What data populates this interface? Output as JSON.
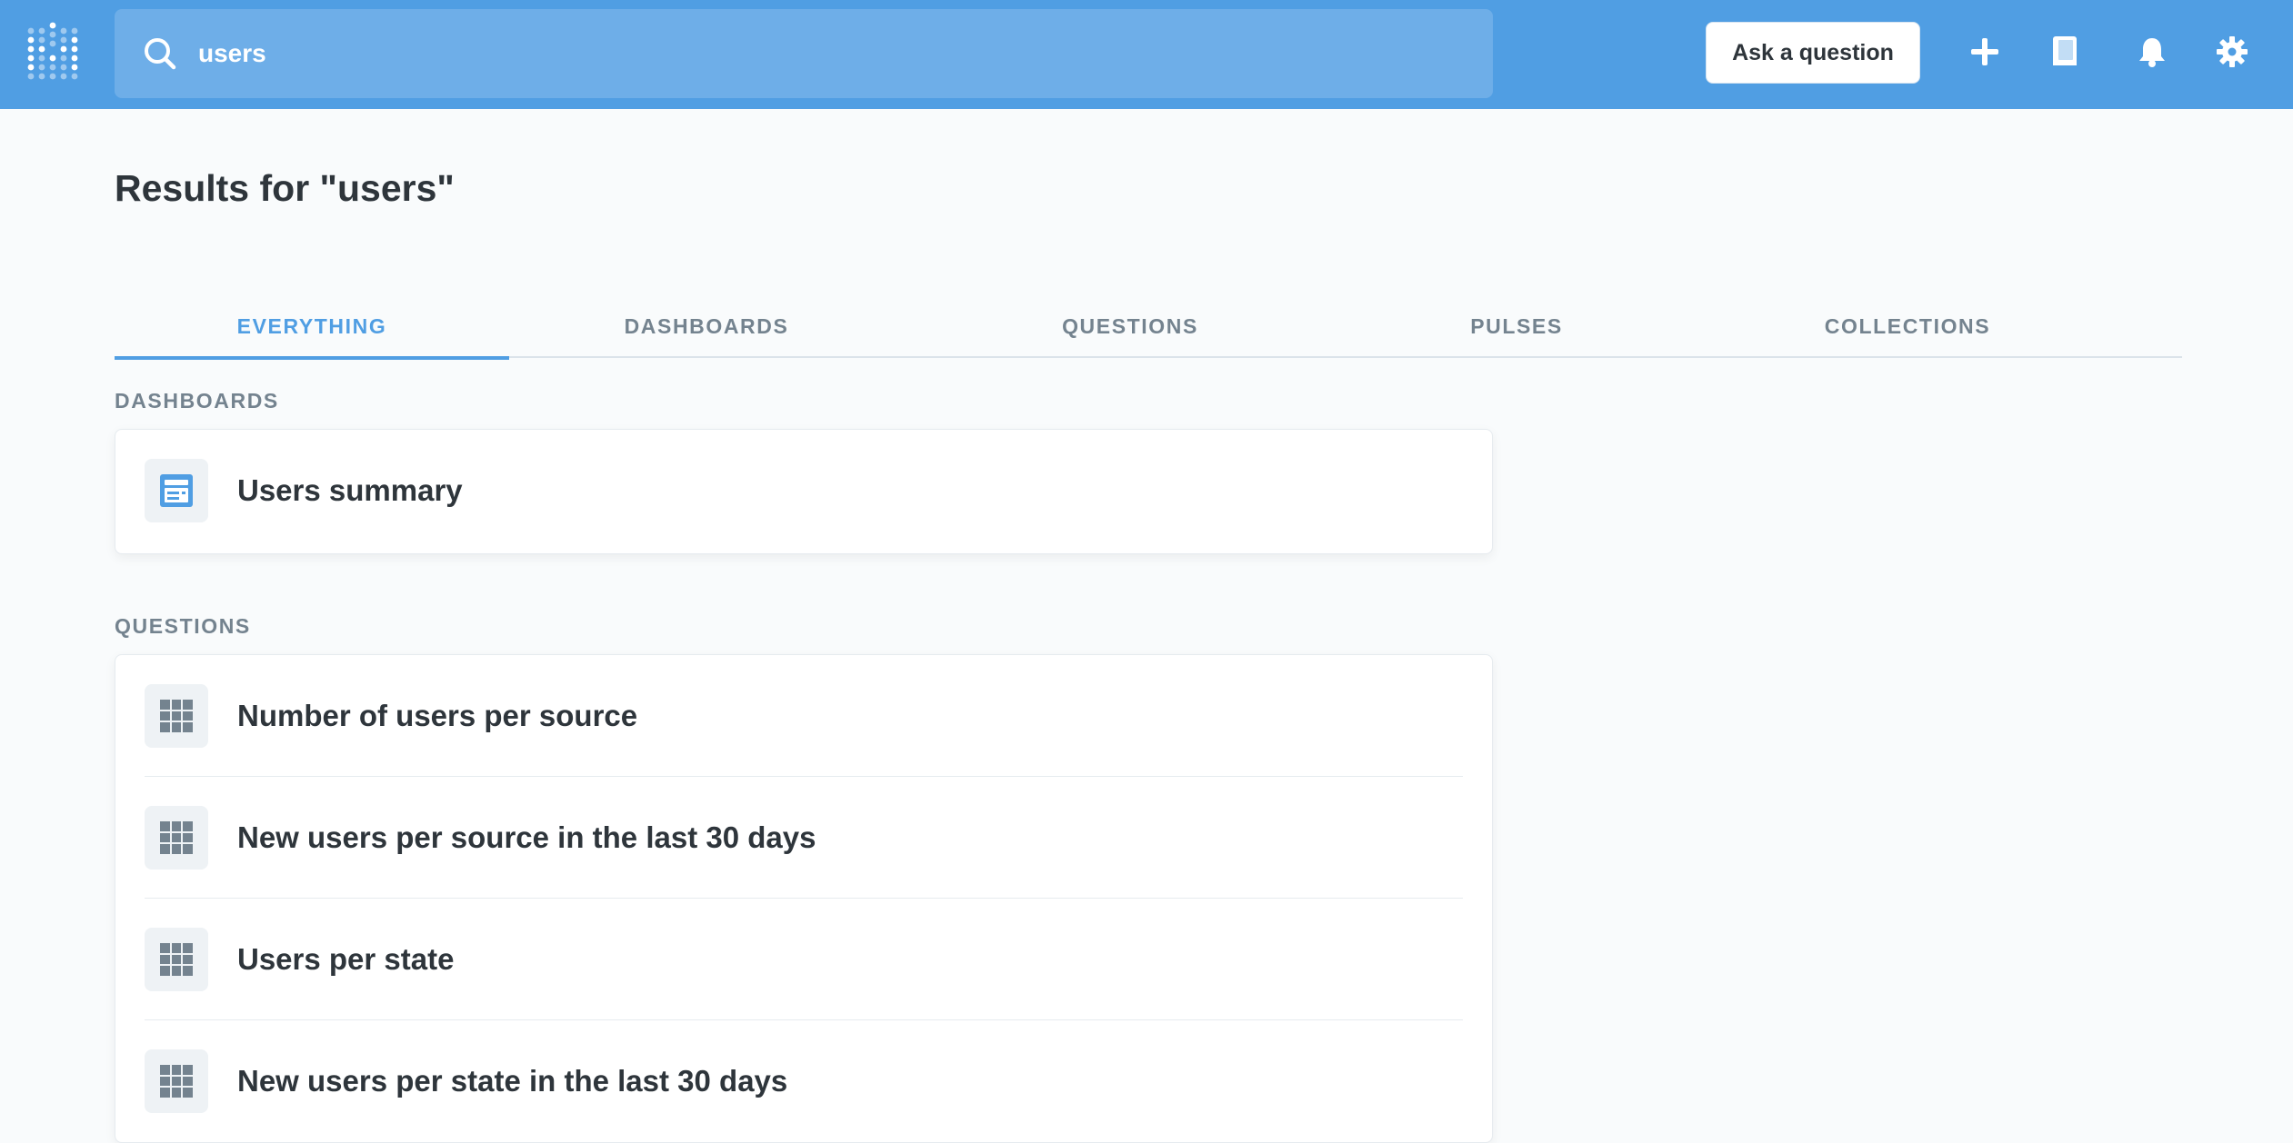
{
  "header": {
    "search": {
      "value": "users",
      "placeholder": "Search…"
    },
    "ask_button_label": "Ask a question",
    "icons": [
      "add-icon",
      "reference-icon",
      "notifications-icon",
      "settings-icon"
    ],
    "brand_color": "#509ee3"
  },
  "page": {
    "title": "Results for \"users\""
  },
  "tabs": [
    {
      "label": "EVERYTHING",
      "active": true
    },
    {
      "label": "DASHBOARDS",
      "active": false
    },
    {
      "label": "QUESTIONS",
      "active": false
    },
    {
      "label": "PULSES",
      "active": false
    },
    {
      "label": "COLLECTIONS",
      "active": false
    }
  ],
  "sections": {
    "dashboards": {
      "label": "DASHBOARDS",
      "items": [
        {
          "name": "Users summary",
          "icon": "dashboard-icon"
        }
      ]
    },
    "questions": {
      "label": "QUESTIONS",
      "items": [
        {
          "name": "Number of users per source",
          "icon": "table-icon"
        },
        {
          "name": "New users per source in the last 30 days",
          "icon": "table-icon"
        },
        {
          "name": "Users per state",
          "icon": "table-icon"
        },
        {
          "name": "New users per state in the last 30 days",
          "icon": "table-icon"
        }
      ]
    }
  },
  "colors": {
    "accent": "#509ee3",
    "text_dark": "#2e353b",
    "text_muted": "#74838f",
    "icon_grey": "#74838f"
  }
}
